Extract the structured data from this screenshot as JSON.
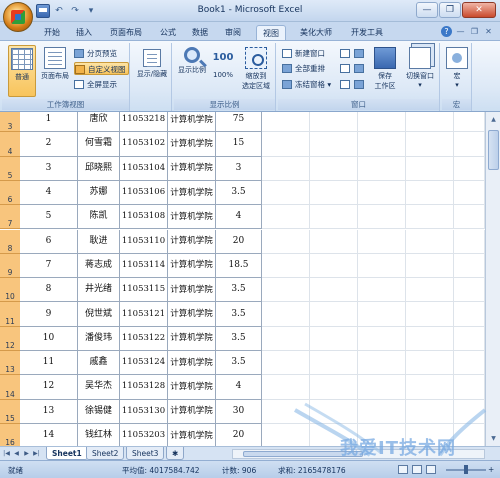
{
  "window": {
    "title": "Book1 - Microsoft Excel",
    "qat_undo": "↶",
    "qat_redo": "↷",
    "qat_more": "▾"
  },
  "tabs": [
    "开始",
    "插入",
    "页面布局",
    "公式",
    "数据",
    "审阅",
    "视图",
    "美化大师",
    "开发工具"
  ],
  "active_tab": "视图",
  "ribbon": {
    "workbook_views": {
      "label": "工作簿视图",
      "normal": "普通",
      "page_layout": "页面布局",
      "page_break": "分页预览",
      "custom_views": "自定义视图",
      "full_screen": "全屏显示"
    },
    "show_hide": {
      "label": "显示/隐藏"
    },
    "zoom": {
      "label": "显示比例",
      "zoom": "显示比例",
      "hundred": "100%",
      "zoom_to_selection_line1": "缩放到",
      "zoom_to_selection_line2": "选定区域",
      "hundred_icon": "100"
    },
    "window": {
      "label": "窗口",
      "new_window": "新建窗口",
      "arrange_all": "全部重排",
      "freeze_panes": "冻结窗格",
      "save_workspace_line1": "保存",
      "save_workspace_line2": "工作区",
      "switch_windows": "切换窗口"
    },
    "macros": {
      "label": "宏",
      "macros": "宏"
    }
  },
  "rows": [
    {
      "row": "3",
      "seq": "1",
      "name": "唐欣",
      "id": "11053218",
      "dept": "计算机学院",
      "score": "75"
    },
    {
      "row": "4",
      "seq": "2",
      "name": "何雪霜",
      "id": "11053102",
      "dept": "计算机学院",
      "score": "15"
    },
    {
      "row": "5",
      "seq": "3",
      "name": "邱晓熙",
      "id": "11053104",
      "dept": "计算机学院",
      "score": "3"
    },
    {
      "row": "6",
      "seq": "4",
      "name": "苏娜",
      "id": "11053106",
      "dept": "计算机学院",
      "score": "3.5"
    },
    {
      "row": "7",
      "seq": "5",
      "name": "陈凯",
      "id": "11053108",
      "dept": "计算机学院",
      "score": "4"
    },
    {
      "row": "8",
      "seq": "6",
      "name": "耿进",
      "id": "11053110",
      "dept": "计算机学院",
      "score": "20"
    },
    {
      "row": "9",
      "seq": "7",
      "name": "蒋志成",
      "id": "11053114",
      "dept": "计算机学院",
      "score": "18.5"
    },
    {
      "row": "10",
      "seq": "8",
      "name": "井光绪",
      "id": "11053115",
      "dept": "计算机学院",
      "score": "3.5"
    },
    {
      "row": "11",
      "seq": "9",
      "name": "倪世斌",
      "id": "11053121",
      "dept": "计算机学院",
      "score": "3.5"
    },
    {
      "row": "12",
      "seq": "10",
      "name": "潘俊玮",
      "id": "11053122",
      "dept": "计算机学院",
      "score": "3.5"
    },
    {
      "row": "13",
      "seq": "11",
      "name": "戚鑫",
      "id": "11053124",
      "dept": "计算机学院",
      "score": "3.5"
    },
    {
      "row": "14",
      "seq": "12",
      "name": "吴华杰",
      "id": "11053128",
      "dept": "计算机学院",
      "score": "4"
    },
    {
      "row": "15",
      "seq": "13",
      "name": "徐锡健",
      "id": "11053130",
      "dept": "计算机学院",
      "score": "30"
    },
    {
      "row": "16",
      "seq": "14",
      "name": "钱红林",
      "id": "11053203",
      "dept": "计算机学院",
      "score": "20"
    }
  ],
  "sheets": [
    "Sheet1",
    "Sheet2",
    "Sheet3"
  ],
  "active_sheet": "Sheet1",
  "status": {
    "mode": "就绪",
    "average": "平均值: 4017584.742",
    "count": "计数: 906",
    "sum": "求和: 2165478176"
  },
  "watermark": "我爱IT技术网",
  "colors": {
    "row_header_selected": "#f8c57d",
    "ribbon_active": "#f8c45c",
    "title_bar": "#c3d6ee"
  }
}
